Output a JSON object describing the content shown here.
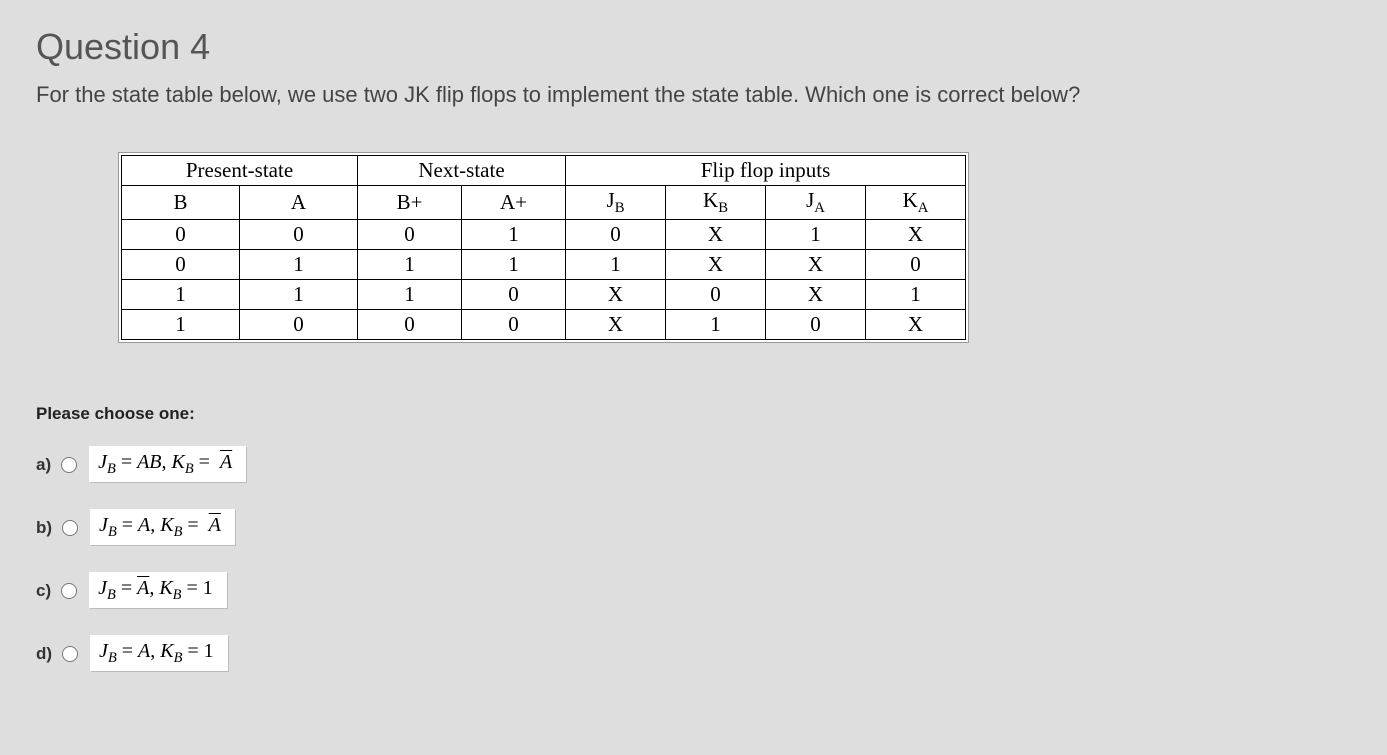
{
  "question": {
    "title": "Question 4",
    "prompt": "For the state table below, we use two JK flip flops to implement the state table. Which one is correct below?"
  },
  "table": {
    "group_headers": [
      "Present-state",
      "Next-state",
      "Flip flop inputs"
    ],
    "sub_headers": {
      "B": "B",
      "A": "A",
      "Bp": "B+",
      "Ap": "A+",
      "JB_base": "J",
      "JB_sub": "B",
      "KB_base": "K",
      "KB_sub": "B",
      "JA_base": "J",
      "JA_sub": "A",
      "KA_base": "K",
      "KA_sub": "A"
    },
    "rows": [
      [
        "0",
        "0",
        "0",
        "1",
        "0",
        "X",
        "1",
        "X"
      ],
      [
        "0",
        "1",
        "1",
        "1",
        "1",
        "X",
        "X",
        "0"
      ],
      [
        "1",
        "1",
        "1",
        "0",
        "X",
        "0",
        "X",
        "1"
      ],
      [
        "1",
        "0",
        "0",
        "0",
        "X",
        "1",
        "0",
        "X"
      ]
    ]
  },
  "choose_label": "Please choose one:",
  "options": {
    "a": {
      "letter": "a)",
      "J_base": "J",
      "J_sub": "B",
      "eq1": " = ",
      "rhs1": "AB",
      "comma": ", ",
      "K_base": "K",
      "K_sub": "B",
      "eq2": " = ",
      "rhs2": "A",
      "rhs2_bar": true
    },
    "b": {
      "letter": "b)",
      "J_base": "J",
      "J_sub": "B",
      "eq1": " = ",
      "rhs1": "A",
      "comma": ", ",
      "K_base": "K",
      "K_sub": "B",
      "eq2": " = ",
      "rhs2": "A",
      "rhs2_bar": true
    },
    "c": {
      "letter": "c)",
      "J_base": "J",
      "J_sub": "B",
      "eq1": " = ",
      "rhs1": "A",
      "rhs1_bar": true,
      "comma": ", ",
      "K_base": "K",
      "K_sub": "B",
      "eq2": " = ",
      "rhs2": " 1"
    },
    "d": {
      "letter": "d)",
      "J_base": "J",
      "J_sub": "B",
      "eq1": " = ",
      "rhs1": "A",
      "comma": ", ",
      "K_base": "K",
      "K_sub": "B",
      "eq2": " = ",
      "rhs2": " 1"
    }
  }
}
